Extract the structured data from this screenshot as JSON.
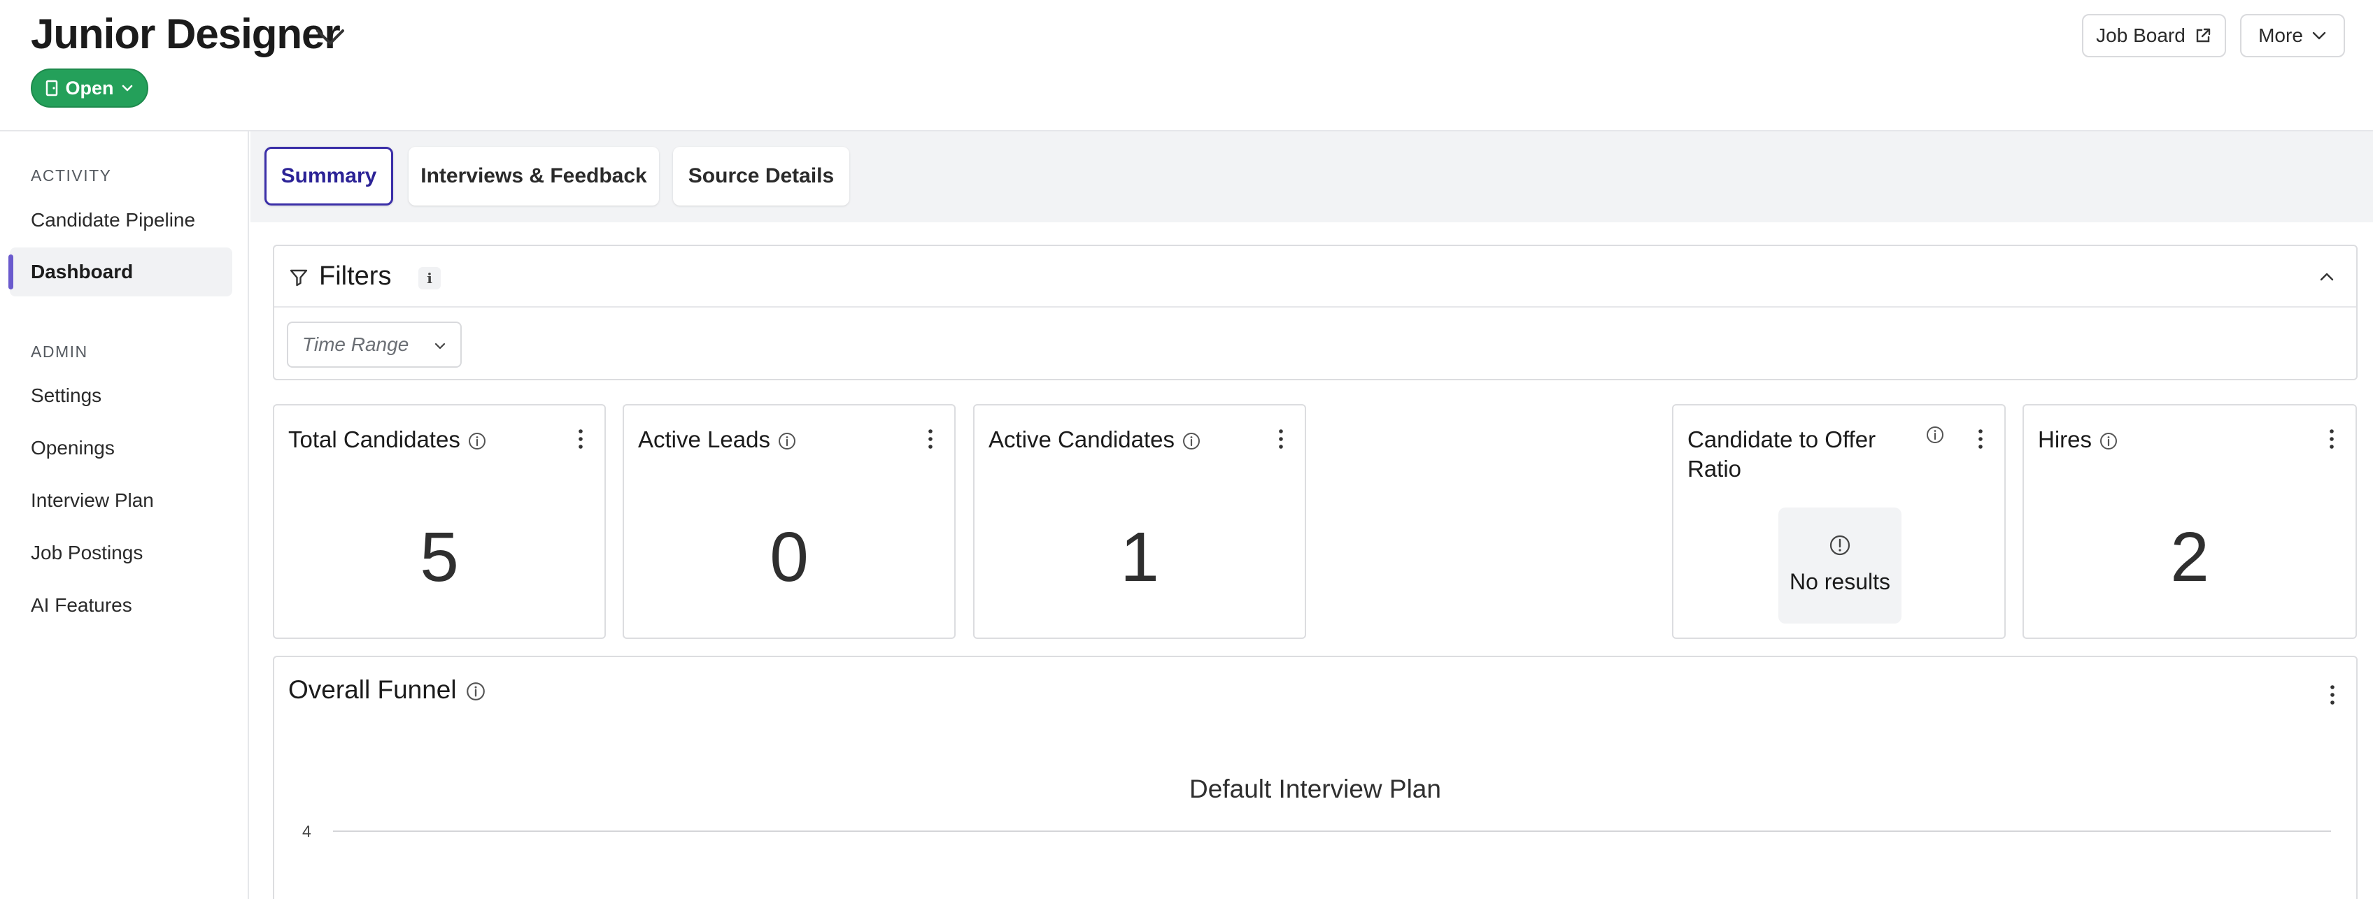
{
  "header": {
    "job_title": "Junior Designer",
    "status": "Open",
    "job_board_label": "Job Board",
    "more_label": "More"
  },
  "sidebar": {
    "activity_label": "ACTIVITY",
    "admin_label": "ADMIN",
    "items": [
      {
        "label": "Candidate Pipeline",
        "active": false
      },
      {
        "label": "Dashboard",
        "active": true
      },
      {
        "label": "Settings",
        "active": false
      },
      {
        "label": "Openings",
        "active": false
      },
      {
        "label": "Interview Plan",
        "active": false
      },
      {
        "label": "Job Postings",
        "active": false
      },
      {
        "label": "AI Features",
        "active": false
      }
    ]
  },
  "tabs": [
    {
      "label": "Summary",
      "active": true
    },
    {
      "label": "Interviews & Feedback",
      "active": false
    },
    {
      "label": "Source Details",
      "active": false
    }
  ],
  "filters": {
    "title": "Filters",
    "info_glyph": "i",
    "time_range_placeholder": "Time Range"
  },
  "metrics": {
    "total_candidates": {
      "label": "Total Candidates",
      "value": "5"
    },
    "active_leads": {
      "label": "Active Leads",
      "value": "0"
    },
    "active_candidates": {
      "label": "Active Candidates",
      "value": "1"
    },
    "candidate_to_offer": {
      "label": "Candidate to Offer Ratio",
      "empty_text": "No results"
    },
    "hires": {
      "label": "Hires",
      "value": "2"
    }
  },
  "funnel": {
    "title": "Overall Funnel",
    "plan_title": "Default Interview Plan",
    "y_tick_top": "4"
  },
  "colors": {
    "status_green": "#24a05a",
    "active_tab_border": "#3b2fa8",
    "sidebar_active_accent": "#6a5acd"
  }
}
